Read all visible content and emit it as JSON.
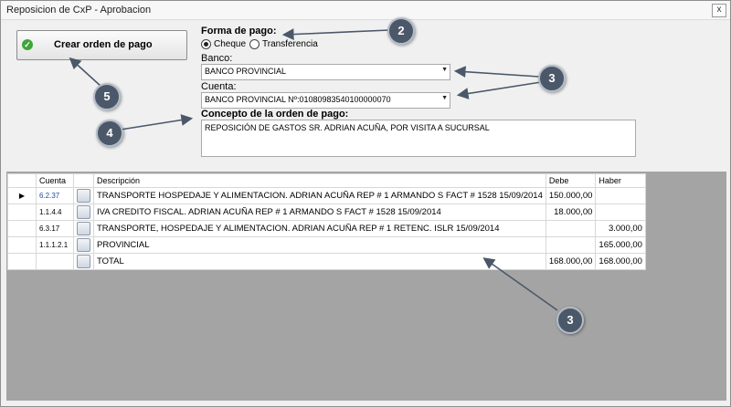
{
  "window": {
    "title": "Reposicion de CxP - Aprobacion",
    "close_glyph": "x"
  },
  "actions": {
    "create_label": "Crear orden de pago",
    "create_icon": "check-circle-icon"
  },
  "payment": {
    "label": "Forma de pago:",
    "options": [
      {
        "label": "Cheque",
        "selected": true
      },
      {
        "label": "Transferencia",
        "selected": false
      }
    ]
  },
  "bank": {
    "label": "Banco:",
    "value": "BANCO PROVINCIAL"
  },
  "account": {
    "label": "Cuenta:",
    "value": "BANCO PROVINCIAL Nº:01080983540100000070"
  },
  "concept": {
    "label": "Concepto de la orden de pago:",
    "value": "REPOSICIÓN DE GASTOS SR. ADRIAN ACUÑA, POR VISITA A SUCURSAL"
  },
  "grid": {
    "headers": {
      "cuenta": "Cuenta",
      "descripcion": "Descripción",
      "debe": "Debe",
      "haber": "Haber"
    },
    "current_row_marker": "▶",
    "rows": [
      {
        "cuenta": "6.2.37",
        "descripcion": "TRANSPORTE HOSPEDAJE Y ALIMENTACION. ADRIAN ACUÑA REP # 1 ARMANDO S FACT # 1528 15/09/2014",
        "debe": "150.000,00",
        "haber": ""
      },
      {
        "cuenta": "1.1.4.4",
        "descripcion": "IVA CREDITO FISCAL. ADRIAN ACUÑA REP # 1 ARMANDO S FACT # 1528 15/09/2014",
        "debe": "18.000,00",
        "haber": ""
      },
      {
        "cuenta": "6.3.17",
        "descripcion": "TRANSPORTE, HOSPEDAJE Y ALIMENTACION. ADRIAN ACUÑA REP # 1 RETENC. ISLR 15/09/2014",
        "debe": "",
        "haber": "3.000,00"
      },
      {
        "cuenta": "1.1.1.2.1",
        "descripcion": "PROVINCIAL",
        "debe": "",
        "haber": "165.000,00"
      },
      {
        "cuenta": "",
        "descripcion": "TOTAL",
        "debe": "168.000,00",
        "haber": "168.000,00"
      }
    ]
  },
  "callouts": [
    "2",
    "3",
    "5",
    "4",
    "3"
  ]
}
